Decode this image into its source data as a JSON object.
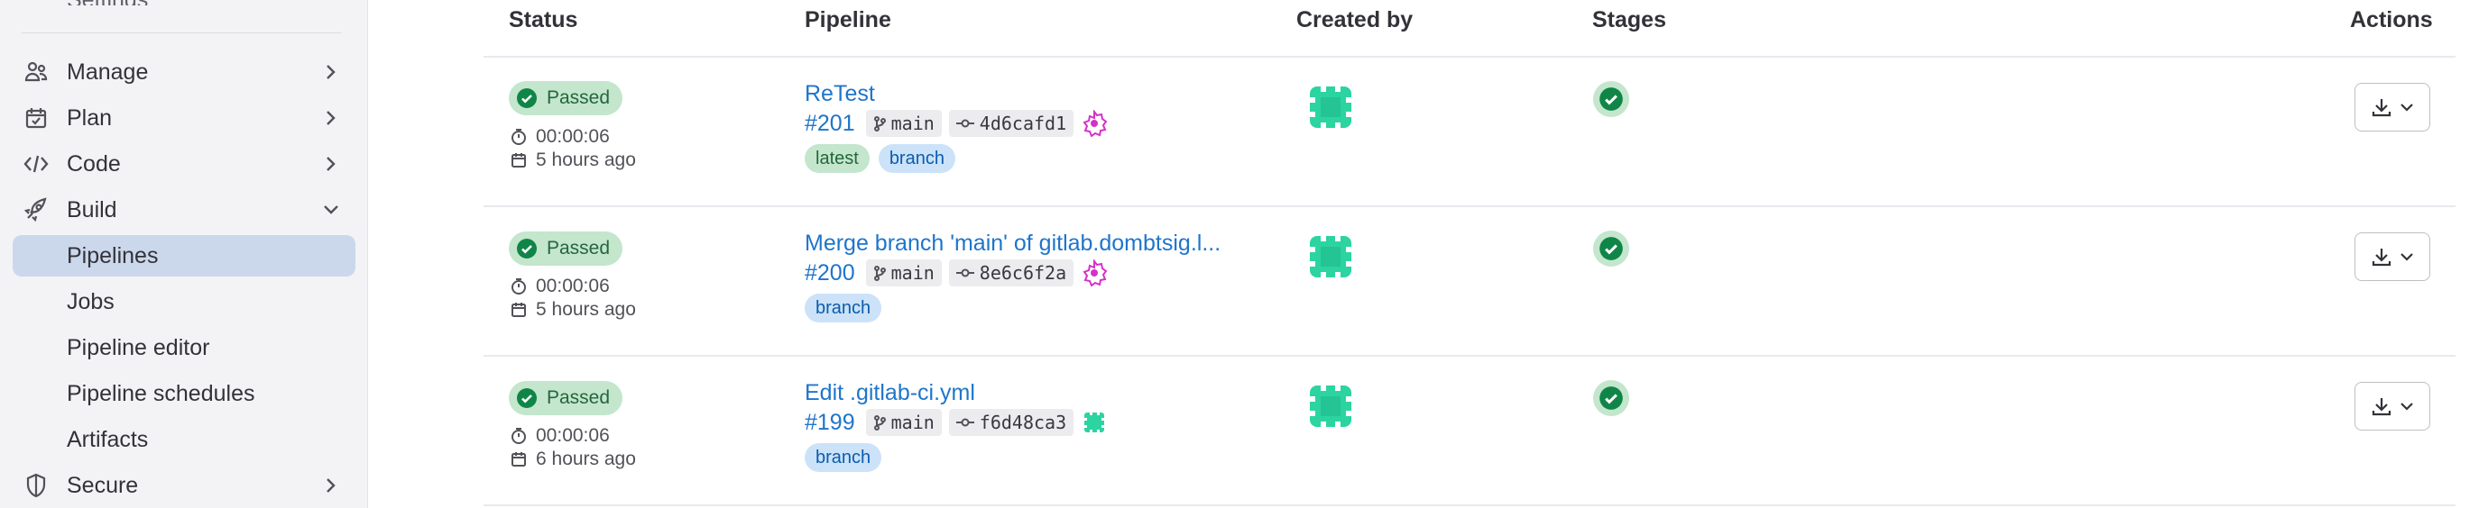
{
  "sidebar": {
    "partial_top_label": "Settings",
    "items": [
      {
        "key": "manage",
        "label": "Manage",
        "icon": "users-icon",
        "expandable": true,
        "expanded": false
      },
      {
        "key": "plan",
        "label": "Plan",
        "icon": "calendar-icon",
        "expandable": true,
        "expanded": false
      },
      {
        "key": "code",
        "label": "Code",
        "icon": "code-icon",
        "expandable": true,
        "expanded": false
      },
      {
        "key": "build",
        "label": "Build",
        "icon": "rocket-icon",
        "expandable": true,
        "expanded": true
      },
      {
        "key": "pipelines",
        "label": "Pipelines",
        "sub": true,
        "active": true
      },
      {
        "key": "jobs",
        "label": "Jobs",
        "sub": true
      },
      {
        "key": "pipeline-editor",
        "label": "Pipeline editor",
        "sub": true
      },
      {
        "key": "pipeline-schedules",
        "label": "Pipeline schedules",
        "sub": true
      },
      {
        "key": "artifacts",
        "label": "Artifacts",
        "sub": true
      },
      {
        "key": "secure",
        "label": "Secure",
        "icon": "shield-icon",
        "expandable": true,
        "expanded": false
      }
    ]
  },
  "table": {
    "headers": {
      "status": "Status",
      "pipeline": "Pipeline",
      "created_by": "Created by",
      "stages": "Stages",
      "actions": "Actions"
    },
    "rows": [
      {
        "status": "Passed",
        "duration": "00:00:06",
        "finished": "5 hours ago",
        "title": "ReTest",
        "id": "#201",
        "branch": "main",
        "commit": "4d6cafd1",
        "tags": [
          {
            "label": "latest",
            "color": "green"
          },
          {
            "label": "branch",
            "color": "blue"
          }
        ]
      },
      {
        "status": "Passed",
        "duration": "00:00:06",
        "finished": "5 hours ago",
        "title": "Merge branch 'main' of gitlab.dombtsig.l...",
        "id": "#200",
        "branch": "main",
        "commit": "8e6c6f2a",
        "tags": [
          {
            "label": "branch",
            "color": "blue"
          }
        ]
      },
      {
        "status": "Passed",
        "duration": "00:00:06",
        "finished": "6 hours ago",
        "title": "Edit .gitlab-ci.yml",
        "id": "#199",
        "branch": "main",
        "commit": "f6d48ca3",
        "tags": [
          {
            "label": "branch",
            "color": "blue"
          }
        ]
      }
    ]
  },
  "colors": {
    "link": "#1f75cb",
    "passed_bg": "#c3e6cd",
    "passed_icon": "#108548",
    "avatar": "#2bd4a0",
    "sidebar_active": "#cbd8ec"
  }
}
